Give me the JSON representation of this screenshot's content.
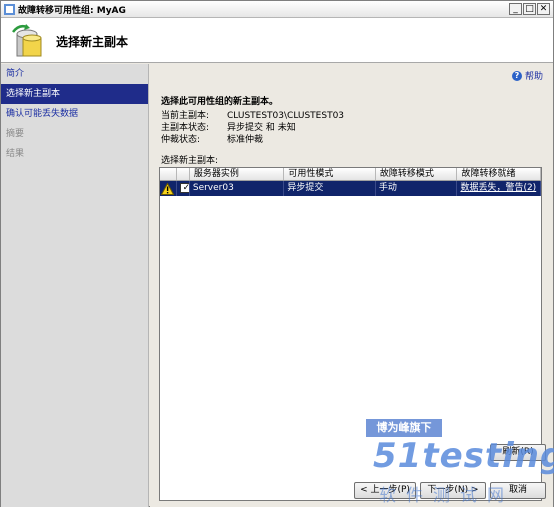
{
  "window": {
    "title": "故障转移可用性组: MyAG"
  },
  "header": {
    "title": "选择新主副本"
  },
  "nav": {
    "items": [
      {
        "label": "简介",
        "state": "link"
      },
      {
        "label": "选择新主副本",
        "state": "active"
      },
      {
        "label": "确认可能丢失数据",
        "state": "link"
      },
      {
        "label": "摘要",
        "state": "disabled"
      },
      {
        "label": "结果",
        "state": "disabled"
      }
    ]
  },
  "main": {
    "help_label": "帮助",
    "title": "选择此可用性组的新主副本。",
    "info": [
      {
        "label": "当前主副本:",
        "value": "CLUSTEST03\\CLUSTEST03"
      },
      {
        "label": "主副本状态:",
        "value": "异步提交 和 未知"
      },
      {
        "label": "仲裁状态:",
        "value": "标准仲裁"
      }
    ],
    "select_label": "选择新主副本:",
    "grid": {
      "columns": [
        "",
        "",
        "服务器实例",
        "可用性模式",
        "故障转移模式",
        "故障转移就绪"
      ],
      "rows": [
        {
          "instance": "Server03",
          "availability_mode": "异步提交",
          "failover_mode": "手动",
          "readiness": "数据丢失，警告(2)"
        }
      ]
    }
  },
  "buttons": {
    "refresh": "刷新(R)",
    "prev": "< 上一步(P)",
    "next": "下一步(N) >",
    "cancel": "取消"
  },
  "watermark": {
    "line1": "博为峰旗下",
    "line2": "51testing",
    "line3": "软件测试网"
  },
  "colors": {
    "nav_active": "#1f2c8a",
    "link": "#1c2fa3",
    "row_selected": "#10246a"
  }
}
